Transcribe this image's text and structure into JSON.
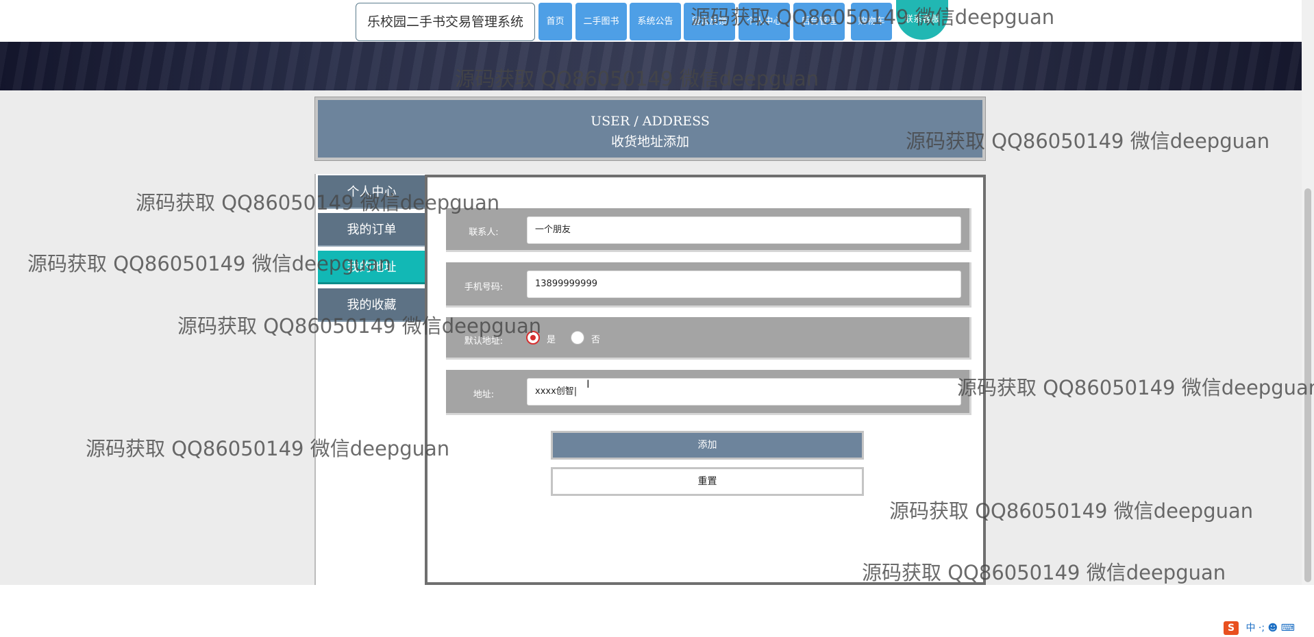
{
  "header": {
    "site_title": "乐校园二手书交易管理系统",
    "nav": [
      {
        "label": "首页"
      },
      {
        "label": "二手图书"
      },
      {
        "label": "系统公告"
      },
      {
        "label": "留言反馈"
      },
      {
        "label": "个人中心"
      },
      {
        "label": "后台管理"
      },
      {
        "label": "购物车"
      }
    ],
    "contact_label": "联系客服"
  },
  "page": {
    "title_en": "USER / ADDRESS",
    "title_zh": "收货地址添加"
  },
  "sidebar": {
    "items": [
      {
        "label": "个人中心",
        "active": false
      },
      {
        "label": "我的订单",
        "active": false
      },
      {
        "label": "我的地址",
        "active": true
      },
      {
        "label": "我的收藏",
        "active": false
      }
    ]
  },
  "form": {
    "contact_label": "联系人:",
    "contact_value": "一个朋友",
    "phone_label": "手机号码:",
    "phone_value": "13899999999",
    "default_label": "默认地址:",
    "default_options": [
      {
        "label": "是",
        "selected": true
      },
      {
        "label": "否",
        "selected": false
      }
    ],
    "address_label": "地址:",
    "address_value": "xxxx创智|",
    "submit_label": "添加",
    "reset_label": "重置"
  },
  "tray": {
    "logo": "S",
    "ime_label": "中 ·; ☻ ⌨"
  },
  "watermark_text": "源码获取 QQ86050149 微信deepguan",
  "colors": {
    "nav_button": "#4e9fe6",
    "accent_teal": "#12b8b5",
    "header_slate": "#6d849c",
    "radio_selected": "#d62f2f"
  }
}
